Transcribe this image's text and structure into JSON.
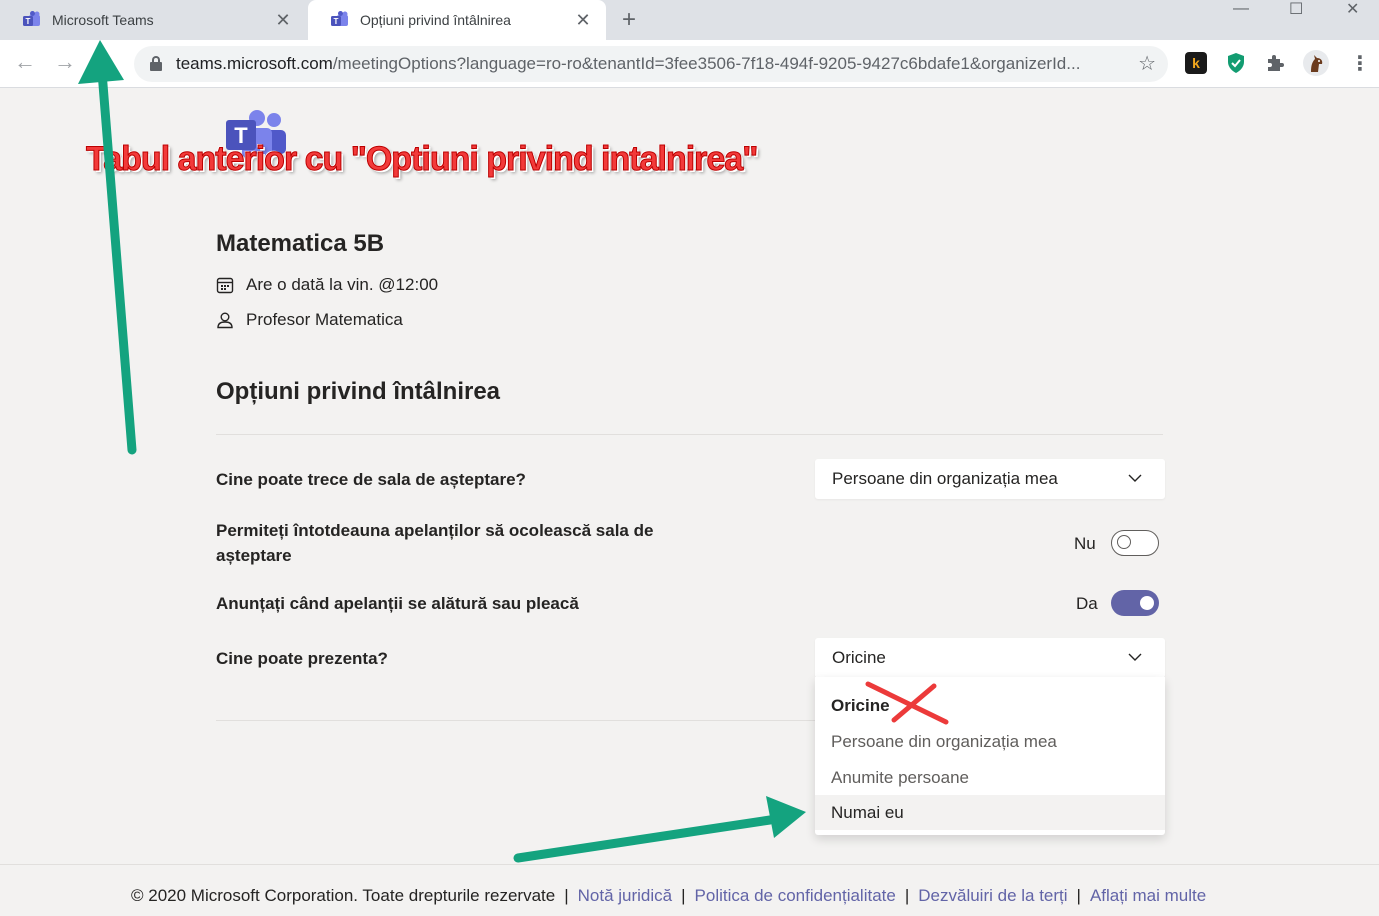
{
  "browser": {
    "tabs": [
      {
        "title": "Microsoft Teams",
        "active": false
      },
      {
        "title": "Opțiuni privind întâlnirea",
        "active": true
      }
    ],
    "new_tab_icon": "plus-icon",
    "address": {
      "host": "teams.microsoft.com",
      "path": "/meetingOptions?language=ro-ro&tenantId=3fee3506-7f18-494f-9205-9427c6bdafe1&organizerId..."
    },
    "extensions": [
      "k-extension-icon",
      "shield-extension-icon",
      "puzzle-icon",
      "profile-avatar"
    ]
  },
  "meeting": {
    "title": "Matematica 5B",
    "schedule": "Are o dată la vin. @12:00",
    "organizer": "Profesor Matematica"
  },
  "options": {
    "section_title": "Opțiuni privind întâlnirea",
    "lobby": {
      "label": "Cine poate trece de sala de așteptare?",
      "value": "Persoane din organizația mea"
    },
    "bypass_callers": {
      "label": "Permiteți întotdeauna apelanților să ocolească sala de așteptare",
      "state_text": "Nu",
      "on": false
    },
    "announce": {
      "label": "Anunțați când apelanții se alătură sau pleacă",
      "state_text": "Da",
      "on": true
    },
    "presenters": {
      "label": "Cine poate prezenta?",
      "value": "Oricine",
      "options": [
        "Oricine",
        "Persoane din organizația mea",
        "Anumite persoane",
        "Numai eu"
      ]
    }
  },
  "footer": {
    "copyright": "© 2020 Microsoft Corporation. Toate drepturile rezervate",
    "links": [
      "Notă juridică",
      "Politica de confidențialitate",
      "Dezvăluiri de la terți",
      "Aflați mai multe"
    ]
  },
  "annotation": {
    "text": "Tabul anterior cu \"Optiuni privind intalnirea\"",
    "arrow_color": "#14a37f",
    "text_color": "#f23a3a"
  },
  "colors": {
    "accent": "#6264a7",
    "page_bg": "#f3f2f1"
  }
}
